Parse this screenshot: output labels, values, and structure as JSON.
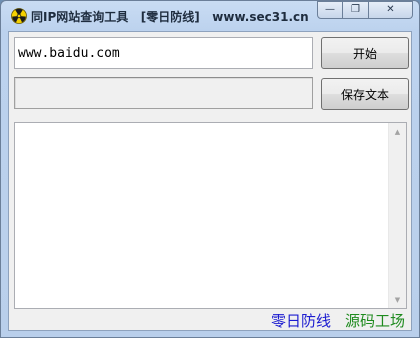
{
  "window": {
    "title": "同IP网站查询工具   [零日防线]   www.sec31.cn",
    "minimize_glyph": "—",
    "restore_glyph": "❐",
    "close_glyph": "✕"
  },
  "form": {
    "url_value": "www.baidu.com",
    "status_value": "",
    "start_label": "开始",
    "save_label": "保存文本"
  },
  "results": {
    "text": ""
  },
  "footer": {
    "link1": "零日防线",
    "link2": "源码工场"
  },
  "icons": {
    "app": "radiation-icon"
  },
  "colors": {
    "link1": "#1c1cd0",
    "link2": "#1e8a1e",
    "titlebar": "#bcd2ee"
  }
}
